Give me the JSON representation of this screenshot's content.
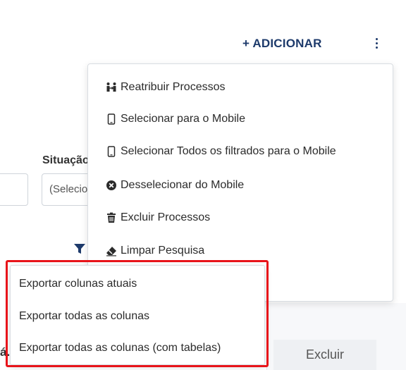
{
  "header": {
    "add_label": "+ ADICIONAR"
  },
  "filters": {
    "situacao_label": "Situação",
    "situacao_placeholder": "(Selecione)"
  },
  "table": {
    "excluir_label": "Excluir",
    "stray_text": "á."
  },
  "actions_menu": {
    "items": [
      {
        "label": "Reatribuir Processos",
        "icon": "people-swap-icon"
      },
      {
        "label": "Selecionar para o Mobile",
        "icon": "mobile-icon"
      },
      {
        "label": "Selecionar Todos os filtrados para o Mobile",
        "icon": "mobile-icon"
      },
      {
        "label": "Desselecionar do Mobile",
        "icon": "circle-x-icon"
      },
      {
        "label": "Excluir Processos",
        "icon": "trash-icon"
      },
      {
        "label": "Limpar Pesquisa",
        "icon": "eraser-icon"
      }
    ]
  },
  "export_menu": {
    "items": [
      {
        "label": "Exportar colunas atuais"
      },
      {
        "label": "Exportar todas as colunas"
      },
      {
        "label": "Exportar todas as colunas (com tabelas)"
      }
    ]
  },
  "colors": {
    "accent": "#1d3a6b",
    "highlight": "#e8141a"
  }
}
